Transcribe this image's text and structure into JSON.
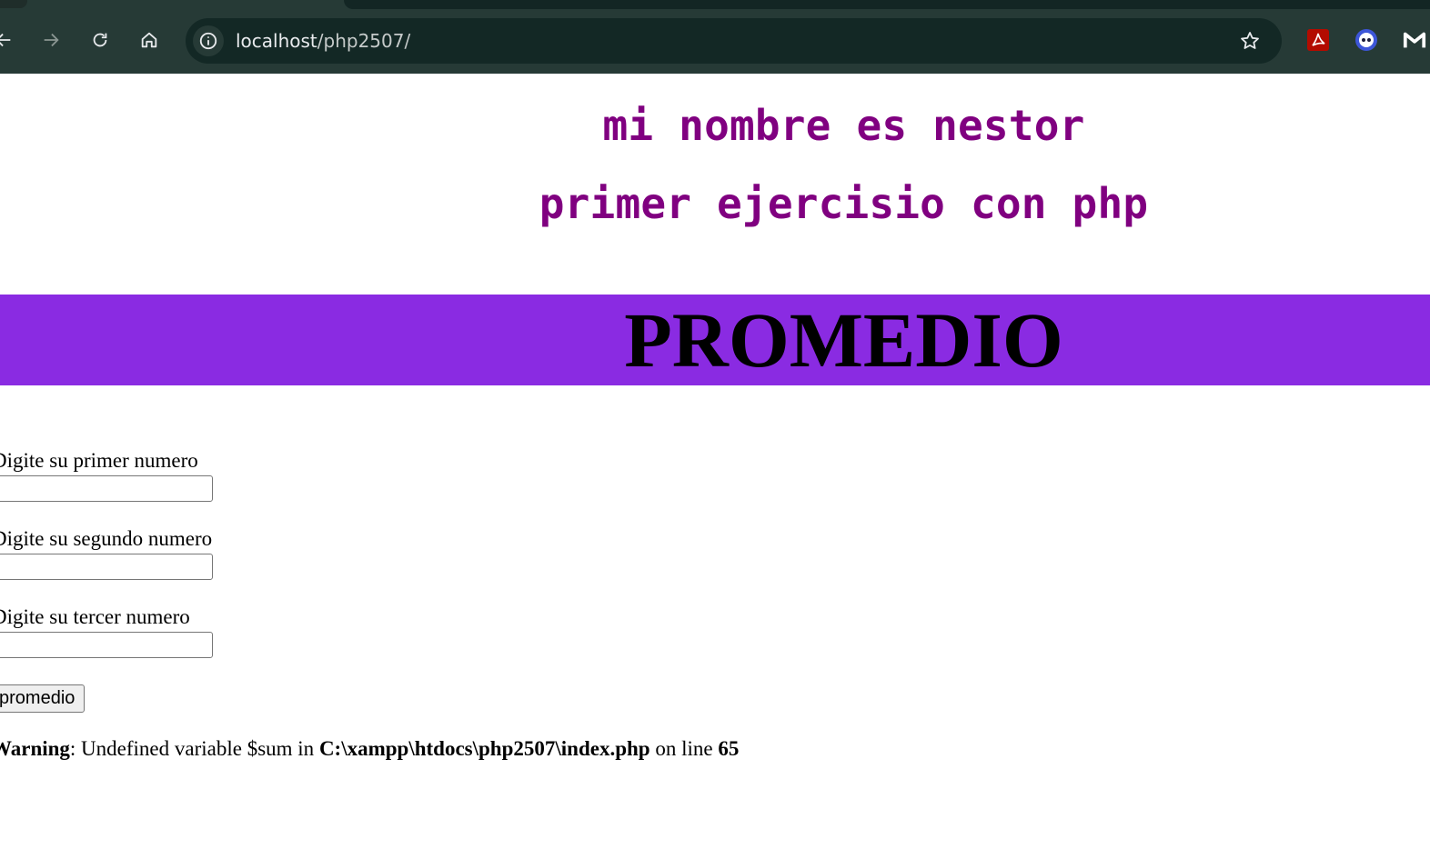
{
  "browser": {
    "url_host": "localhost",
    "url_path": "/php2507/",
    "icons": {
      "back": "back-arrow-icon",
      "forward": "forward-arrow-icon",
      "reload": "reload-icon",
      "home": "home-icon",
      "site_info": "info-icon",
      "bookmark": "star-icon",
      "extensions": [
        "acrobat-icon",
        "bitwarden-like-icon",
        "malwarebytes-icon"
      ]
    },
    "colors": {
      "chrome_bg": "#263a36",
      "omnibox_bg": "#132825",
      "omnibox_text": "#e8eaed"
    }
  },
  "page": {
    "heading_name": "mi nombre es nestor",
    "heading_sub": "primer ejercisio con php",
    "banner_title": "PROMEDIO",
    "fields": [
      {
        "label": "Digite su primer numero",
        "value": ""
      },
      {
        "label": "Digite su segundo numero",
        "value": ""
      },
      {
        "label": "Digite su tercer numero",
        "value": ""
      }
    ],
    "submit_label": "promedio",
    "warning": {
      "prefix": "Warning",
      "message": ": Undefined variable $sum in ",
      "file": "C:\\xampp\\htdocs\\php2507\\index.php",
      "line_text": " on line ",
      "line": "65"
    },
    "colors": {
      "heading": "#800080",
      "banner_bg": "#8a2be2",
      "banner_text": "#000000"
    }
  }
}
